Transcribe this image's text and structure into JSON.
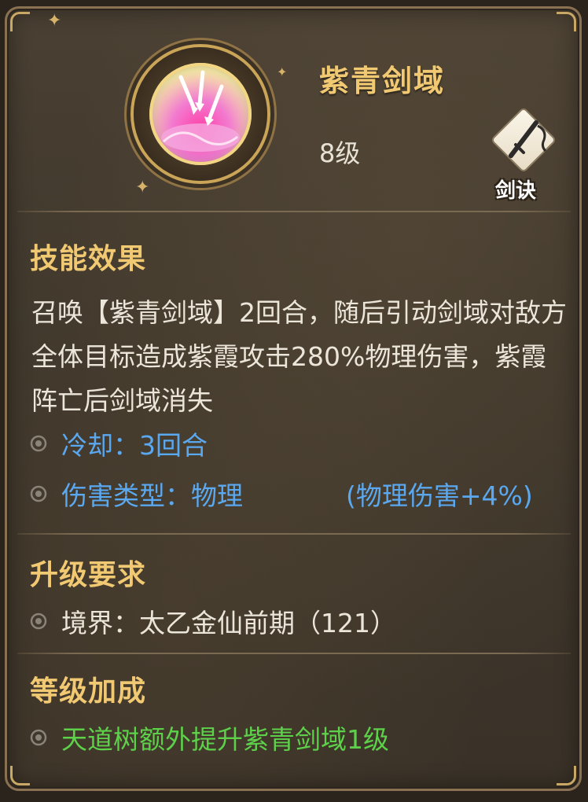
{
  "skill": {
    "name": "紫青剑域",
    "level": "8级",
    "icon": "sword-domain-skill-icon",
    "type_badge": {
      "icon": "sword-icon",
      "label": "剑诀"
    }
  },
  "effect": {
    "title": "技能效果",
    "description": "召唤【紫青剑域】2回合，随后引动剑域对敌方全体目标造成紫霞攻击280%物理伤害，紫霞阵亡后剑域消失",
    "cooldown": "冷却：3回合",
    "damage_type": "伤害类型：物理",
    "damage_bonus": "(物理伤害+4%)"
  },
  "upgrade": {
    "title": "升级要求",
    "realm": "境界：太乙金仙前期（121）"
  },
  "bonus": {
    "title": "等级加成",
    "text": "天道树额外提升紫青剑域1级"
  },
  "colors": {
    "title_gold": "#f2c973",
    "stat_blue": "#5aa8f0",
    "bonus_green": "#5dd14a",
    "frame": "#8a7152"
  }
}
